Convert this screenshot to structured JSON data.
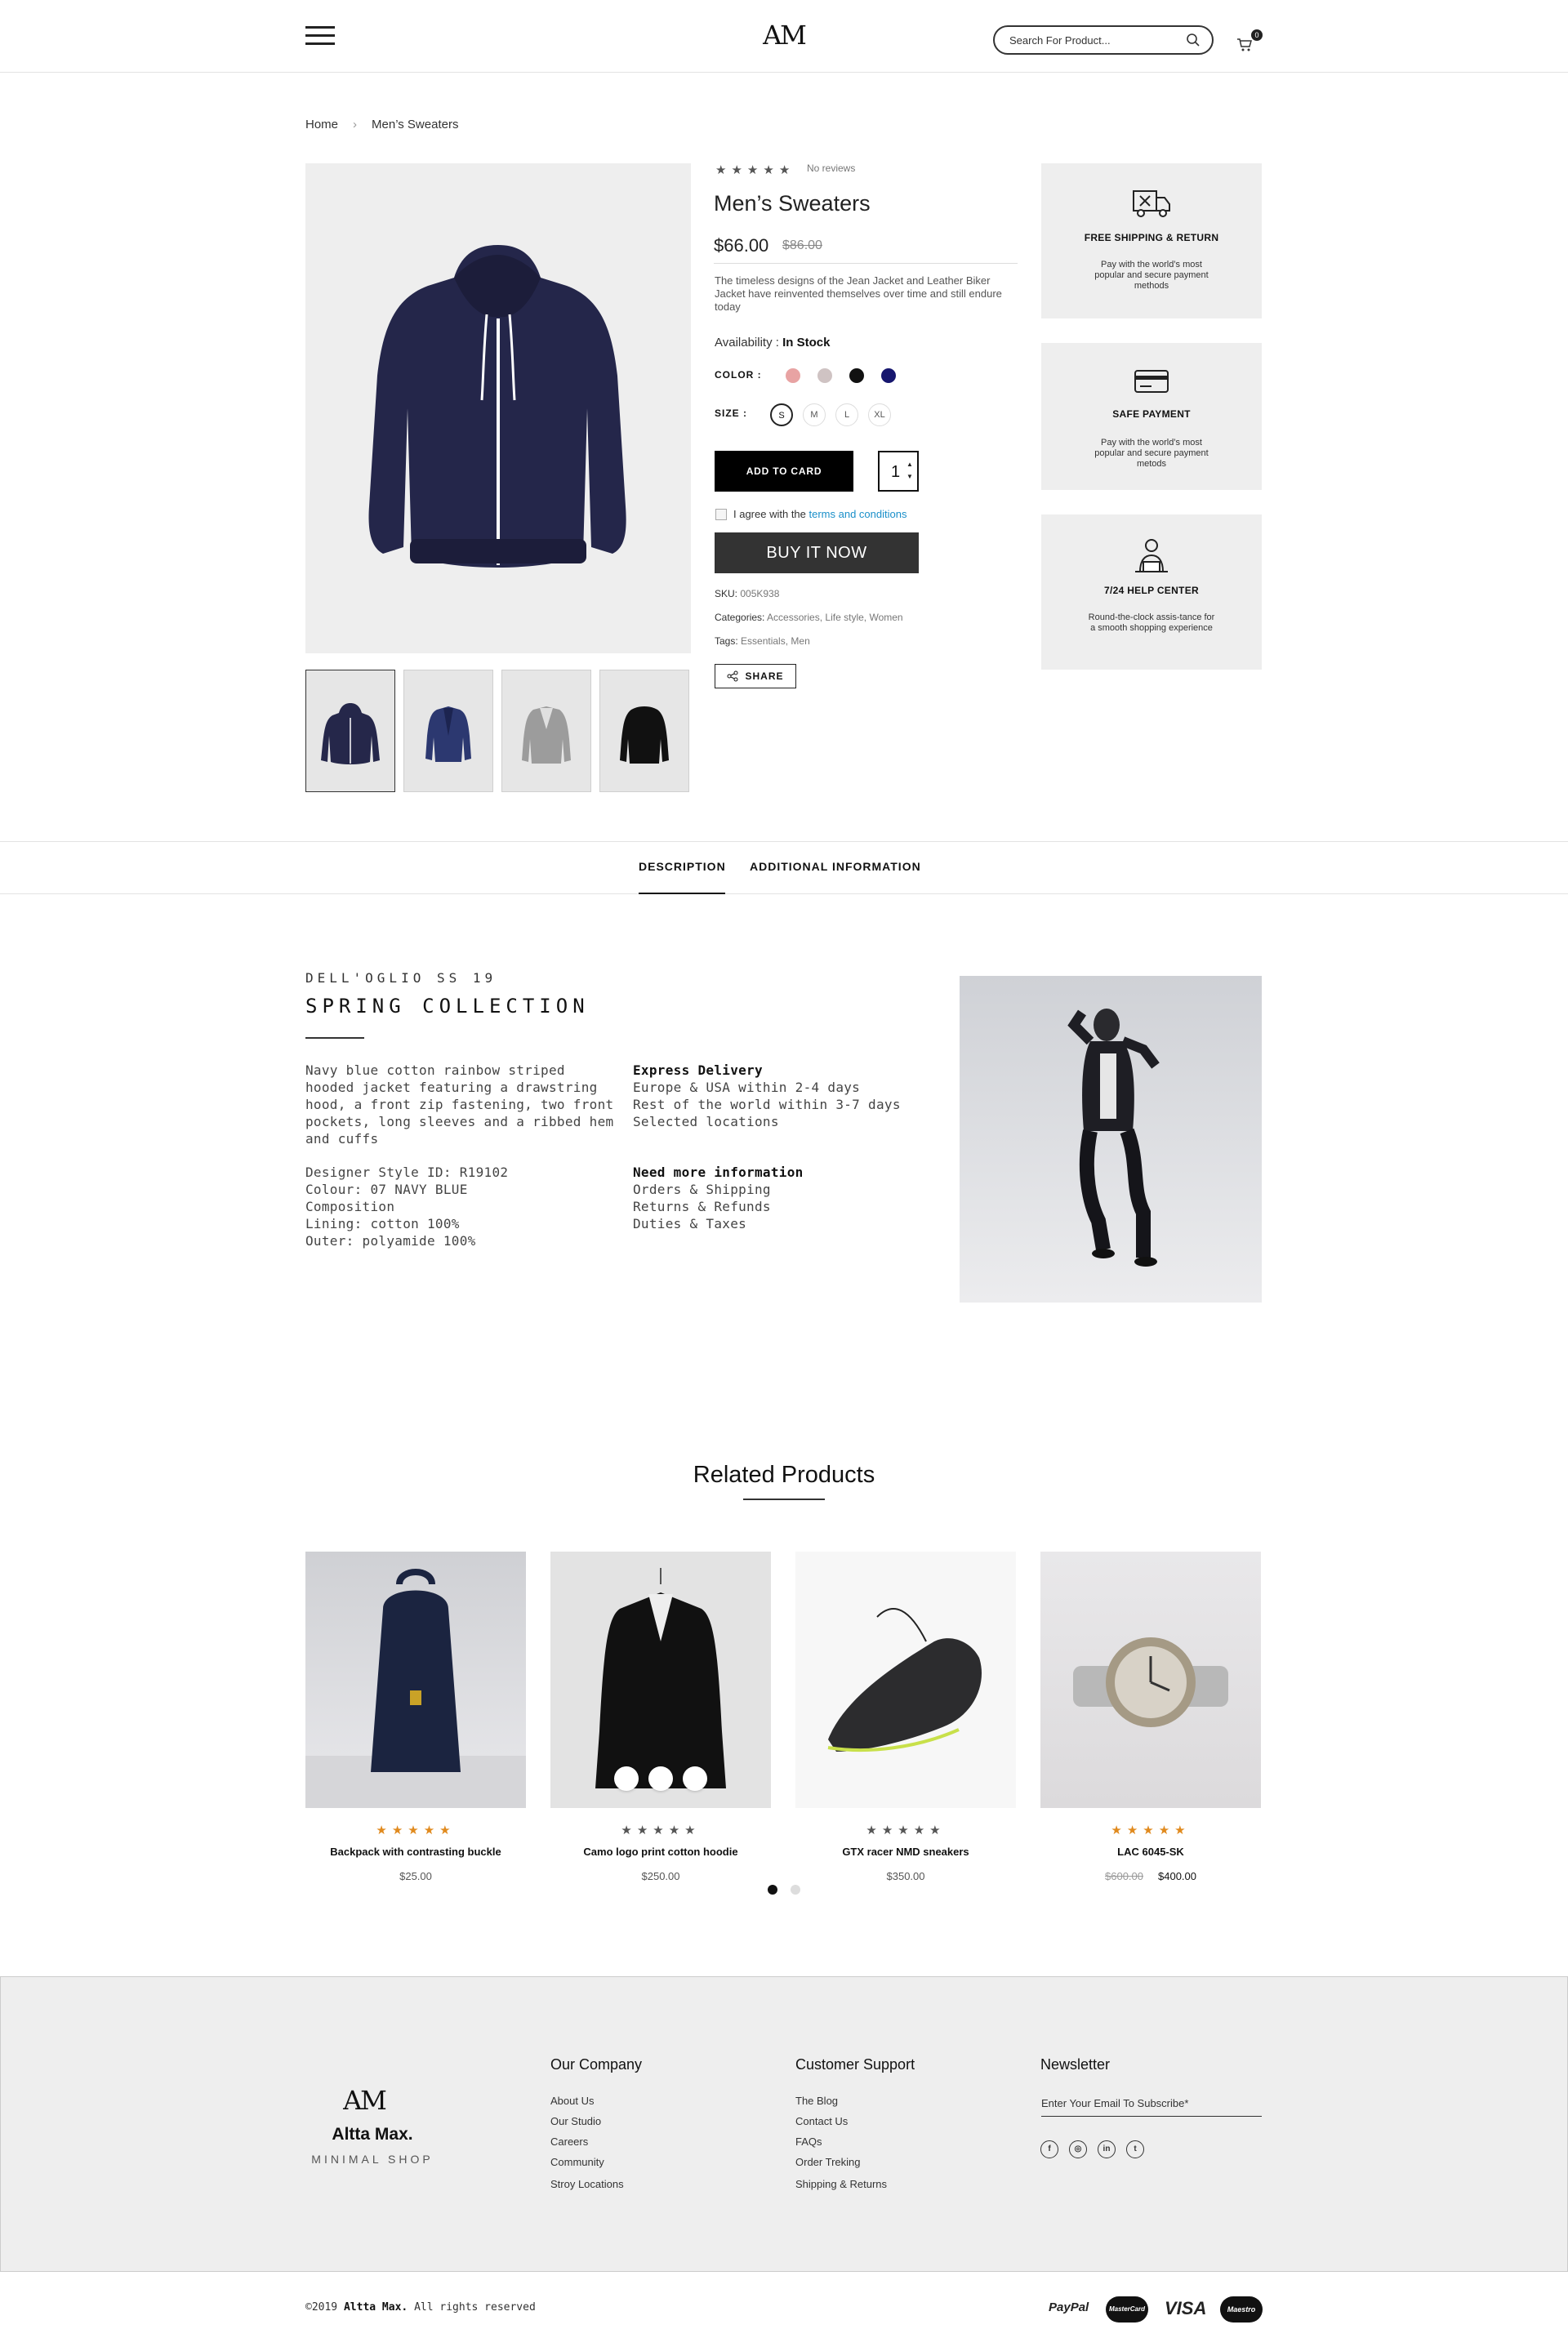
{
  "header": {
    "logo": "AM",
    "search_placeholder": "Search For Product...",
    "cart_count": "0"
  },
  "breadcrumb": [
    "Home",
    "Men’s Sweaters"
  ],
  "product": {
    "reviews": "No reviews",
    "title": "Men’s Sweaters",
    "price": "$66.00",
    "old_price": "$86.00",
    "description": "The timeless designs of the Jean Jacket and Leather Biker Jacket have reinvented themselves over time and still endure today",
    "availability_label": "Availability :",
    "availability_value": "In Stock",
    "color_label": "COLOR :",
    "colors": [
      "#e8a3a3",
      "#cfc3c3",
      "#111111",
      "#16166e"
    ],
    "size_label": "SIZE :",
    "sizes": [
      "S",
      "M",
      "L",
      "XL"
    ],
    "selected_size": "S",
    "add_to_card": "ADD TO CARD",
    "quantity": "1",
    "agree_text": "I agree with the",
    "agree_link": "terms and conditions",
    "buy_now": "BUY IT NOW",
    "sku_label": "SKU:",
    "sku": "005K938",
    "categories_label": "Categories:",
    "categories": [
      "Accessories",
      "Life style",
      "Women"
    ],
    "tags_label": "Tags:",
    "tags": [
      "Essentials",
      "Men"
    ],
    "share": "SHARE"
  },
  "features": [
    {
      "title": "FREE SHIPPING & RETURN",
      "text": "Pay with the world’s most popular and secure payment methods",
      "icon": "truck-icon"
    },
    {
      "title": "SAFE PAYMENT",
      "text": "Pay with the world’s most popular and secure payment metods",
      "icon": "credit-card-icon"
    },
    {
      "title": "7/24 HELP CENTER",
      "text": "Round-the-clock assis-tance for a smooth shopping experience",
      "icon": "support-agent-icon"
    }
  ],
  "tabs": [
    "DESCRIPTION",
    "ADDITIONAL INFORMATION"
  ],
  "description": {
    "kicker": "DELL'OGLIO SS 19",
    "title": "SPRING COLLECTION",
    "intro": "Navy blue cotton rainbow striped hooded jacket featuring a drawstring hood, a front zip fastening, two front pockets, long sleeves and a ribbed hem and cuffs",
    "delivery_title": "Express Delivery",
    "delivery_lines": [
      "Europe & USA within 2-4 days",
      "Rest of the world within 3-7 days",
      "Selected locations"
    ],
    "specs": [
      "Designer Style ID: R19102",
      "Colour: 07 NAVY BLUE",
      "Composition",
      "Lining: cotton 100%",
      "Outer: polyamide 100%"
    ],
    "info_title": "Need more information",
    "info_lines": [
      "Orders & Shipping",
      "Returns & Refunds",
      "Duties & Taxes"
    ]
  },
  "related": {
    "title": "Related Products",
    "products": [
      {
        "name": "Backpack with contrasting buckle",
        "price": "$25.00",
        "old_price": "",
        "stars_color": "#e08a1e"
      },
      {
        "name": "Camo logo print cotton hoodie",
        "price": "$250.00",
        "old_price": "",
        "stars_color": "#555555"
      },
      {
        "name": "GTX racer NMD sneakers",
        "price": "$350.00",
        "old_price": "",
        "stars_color": "#555555"
      },
      {
        "name": "LAC 6045-SK",
        "price": "$400.00",
        "old_price": "$600.00",
        "stars_color": "#e08a1e"
      }
    ]
  },
  "footer": {
    "logo": "AM",
    "brand": "Altta Max.",
    "tagline": "MINIMAL SHOP",
    "company_title": "Our Company",
    "company_links": [
      "About Us",
      "Our Studio",
      "Careers",
      "Community",
      "Stroy Locations"
    ],
    "support_title": "Customer Support",
    "support_links": [
      "The Blog",
      "Contact Us",
      "FAQs",
      "Order Treking",
      "Shipping & Returns"
    ],
    "newsletter_title": "Newsletter",
    "newsletter_placeholder": "Enter Your Email To Subscribe*",
    "social": [
      "facebook-icon",
      "instagram-icon",
      "linkedin-icon",
      "twitter-icon"
    ],
    "copyright_prefix": "©2019",
    "copyright_brand": "Altta Max.",
    "copyright_suffix": "All rights reserved",
    "payments": [
      "PayPal",
      "MasterCard",
      "VISA",
      "Maestro"
    ]
  }
}
